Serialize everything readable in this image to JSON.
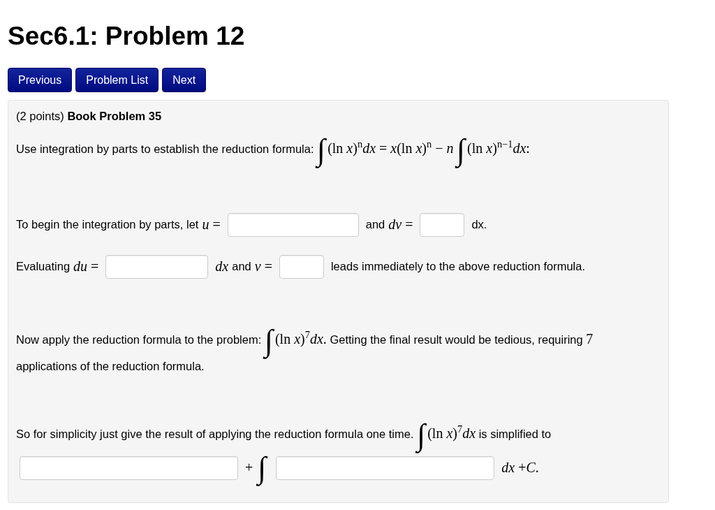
{
  "title": "Sec6.1: Problem 12",
  "nav_buttons": [
    {
      "label": "Previous"
    },
    {
      "label": "Problem List"
    },
    {
      "label": "Next"
    }
  ],
  "problem": {
    "intro": "(2 points) **Book Problem 35**",
    "lines": [
      {
        "segments": [
          {
            "kind": "text",
            "text": "Use integration by parts to establish the reduction formula:"
          },
          {
            "kind": "integral",
            "text": "∫"
          },
          {
            "kind": "math",
            "text": "(ln *x*)$^{n}$*dx* = *x*(ln *x*)$^{n}$ − *n*"
          },
          {
            "kind": "integral",
            "text": "∫"
          },
          {
            "kind": "math",
            "text": "(ln *x*)$^{n−1}$*dx*:"
          }
        ]
      },
      {
        "segments": [
          {
            "kind": "text",
            "text": "To begin the integration by parts, let"
          },
          {
            "kind": "math",
            "text": "*u* ="
          },
          {
            "kind": "input"
          },
          {
            "kind": "text",
            "text": "and"
          },
          {
            "kind": "math",
            "text": "*dv* ="
          },
          {
            "kind": "input"
          },
          {
            "kind": "text",
            "text": "dx."
          }
        ]
      },
      {
        "segments": [
          {
            "kind": "text",
            "text": "Evaluating"
          },
          {
            "kind": "math",
            "text": "*du* ="
          },
          {
            "kind": "input"
          },
          {
            "kind": "math",
            "text": "*dx*"
          },
          {
            "kind": "text",
            "text": "and"
          },
          {
            "kind": "math",
            "text": "*v* ="
          },
          {
            "kind": "input"
          },
          {
            "kind": "text",
            "text": "leads immediately to the above reduction formula."
          }
        ]
      },
      {
        "segments": [
          {
            "kind": "text",
            "text": "Now apply the reduction formula to the problem:"
          },
          {
            "kind": "integral",
            "text": "∫"
          },
          {
            "kind": "math",
            "text": "(ln *x*)$^{7}$*dx*."
          },
          {
            "kind": "text",
            "text": "Getting the final result would be tedious, requiring"
          },
          {
            "kind": "math",
            "text": "7"
          },
          {
            "kind": "text",
            "text": "applications of the reduction formula."
          }
        ]
      },
      {
        "segments": [
          {
            "kind": "text",
            "text": "So for simplicity just give the result of applying the reduction formula one time."
          },
          {
            "kind": "integral",
            "text": "∫"
          },
          {
            "kind": "math",
            "text": "(ln *x*)$^{7}$*dx*"
          },
          {
            "kind": "text",
            "text": "is simplified to"
          }
        ]
      },
      {
        "segments": [
          {
            "kind": "input"
          },
          {
            "kind": "math",
            "text": "+"
          },
          {
            "kind": "integral",
            "text": "∫"
          },
          {
            "kind": "input"
          },
          {
            "kind": "math",
            "text": "*dx* +*C*."
          }
        ]
      }
    ]
  }
}
